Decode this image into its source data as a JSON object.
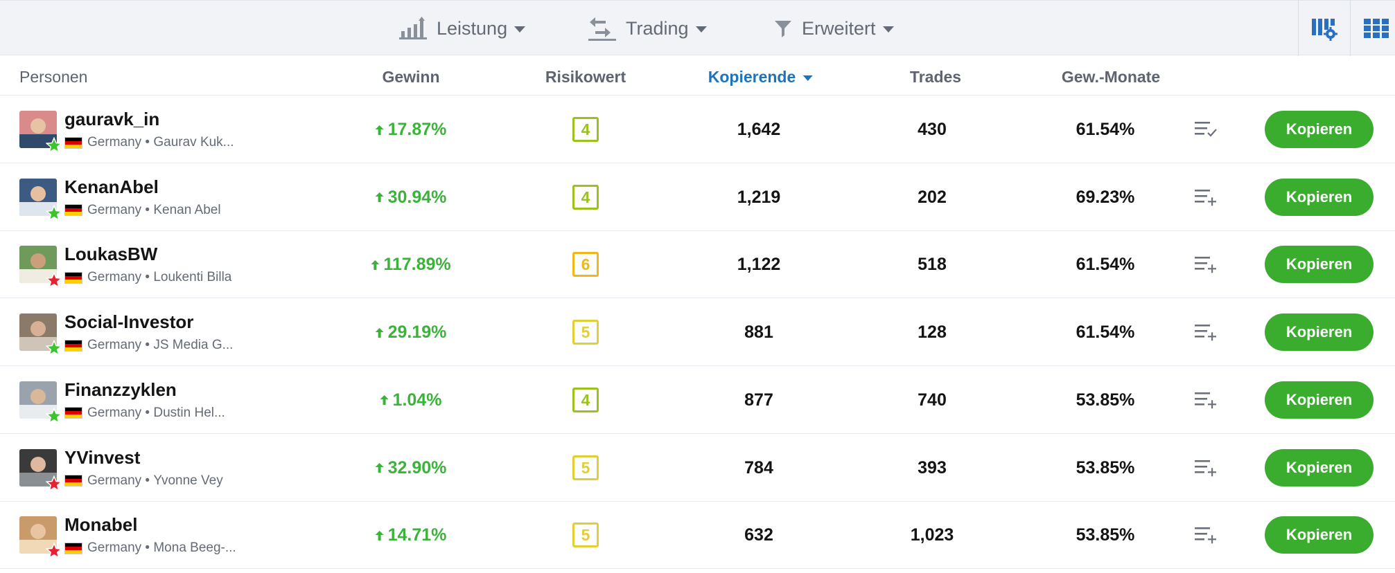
{
  "filters": [
    {
      "label": "Leistung",
      "icon": "bar-chart-icon"
    },
    {
      "label": "Trading",
      "icon": "swap-arrows-icon"
    },
    {
      "label": "Erweitert",
      "icon": "funnel-icon"
    }
  ],
  "view_buttons": [
    "grid-settings-icon",
    "grid-view-icon"
  ],
  "columns": {
    "people": "Personen",
    "gain": "Gewinn",
    "risk": "Risikowert",
    "copiers": "Kopierende",
    "trades": "Trades",
    "profitable_months": "Gew.-Monate"
  },
  "sort_column": "copiers",
  "copy_label": "Kopieren",
  "colors": {
    "positive": "#3bb33a",
    "accent": "#1c75bc",
    "copy_button": "#3aad2e",
    "risk_4": "#9bc21c",
    "risk_5": "#e1cf36",
    "risk_6": "#f2b51a",
    "star_green": "#3cc42e",
    "star_red": "#e8212f"
  },
  "rows": [
    {
      "username": "gauravk_in",
      "country": "Germany",
      "meta_name": "Gaurav Kuk...",
      "gain": "17.87%",
      "risk": "4",
      "copiers": "1,642",
      "trades": "430",
      "profitable_months": "61.54%",
      "star": "green-star-icon",
      "watch_icon": "watchlist-check-icon"
    },
    {
      "username": "KenanAbel",
      "country": "Germany",
      "meta_name": "Kenan Abel",
      "gain": "30.94%",
      "risk": "4",
      "copiers": "1,219",
      "trades": "202",
      "profitable_months": "69.23%",
      "star": "green-star-icon",
      "watch_icon": "watchlist-add-icon"
    },
    {
      "username": "LoukasBW",
      "country": "Germany",
      "meta_name": "Loukenti Billa",
      "gain": "117.89%",
      "risk": "6",
      "copiers": "1,122",
      "trades": "518",
      "profitable_months": "61.54%",
      "star": "red-star-icon",
      "watch_icon": "watchlist-add-icon"
    },
    {
      "username": "Social-Investor",
      "country": "Germany",
      "meta_name": "JS Media G...",
      "gain": "29.19%",
      "risk": "5",
      "copiers": "881",
      "trades": "128",
      "profitable_months": "61.54%",
      "star": "green-star-icon",
      "watch_icon": "watchlist-add-icon"
    },
    {
      "username": "Finanzzyklen",
      "country": "Germany",
      "meta_name": "Dustin Hel...",
      "gain": "1.04%",
      "risk": "4",
      "copiers": "877",
      "trades": "740",
      "profitable_months": "53.85%",
      "star": "green-star-icon",
      "watch_icon": "watchlist-add-icon"
    },
    {
      "username": "YVinvest",
      "country": "Germany",
      "meta_name": "Yvonne Vey",
      "gain": "32.90%",
      "risk": "5",
      "copiers": "784",
      "trades": "393",
      "profitable_months": "53.85%",
      "star": "red-star-icon",
      "watch_icon": "watchlist-add-icon"
    },
    {
      "username": "Monabel",
      "country": "Germany",
      "meta_name": "Mona Beeg-...",
      "gain": "14.71%",
      "risk": "5",
      "copiers": "632",
      "trades": "1,023",
      "profitable_months": "53.85%",
      "star": "red-star-icon",
      "watch_icon": "watchlist-add-icon"
    }
  ]
}
